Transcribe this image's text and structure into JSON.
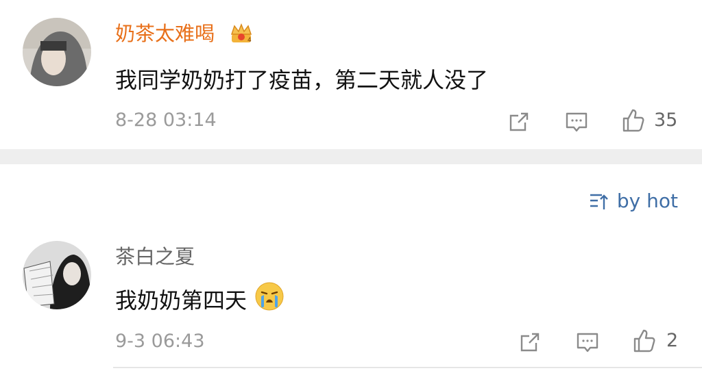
{
  "comments": [
    {
      "username": "奶茶太难喝",
      "badge_icon": "crown-badge-icon",
      "text": "我同学奶奶打了疫苗，第二天就人没了",
      "timestamp": "8-28 03:14",
      "likes": "35"
    },
    {
      "username": "茶白之夏",
      "text": "我奶奶第四天",
      "emoji_icon": "crying-face-icon",
      "timestamp": "9-3 06:43",
      "likes": "2"
    }
  ],
  "sort": {
    "label": "by hot",
    "icon": "sort-icon"
  },
  "colors": {
    "username_highlight": "#e8701a",
    "link": "#3f6ea6",
    "separator": "#eeeeee"
  }
}
